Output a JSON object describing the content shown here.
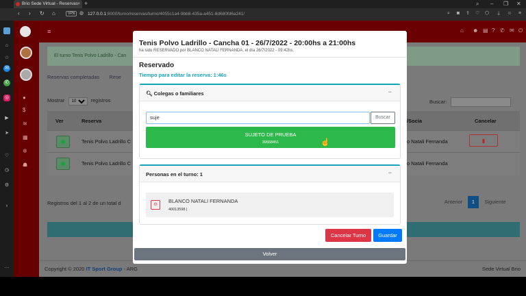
{
  "browser": {
    "tab_title": "Brio Sede Virtual - Reservas",
    "url_host": "127.0.0.1",
    "url_path": ":8000/turno/reservas/turno/4055c1a4-9bb8-435a-a451-8d680fd6a241/",
    "vpn_label": "VPN"
  },
  "page_bg": {
    "alert_text": "El turno Tenis Polvo Ladrillo - Can",
    "tab_completed": "Reservas completadas",
    "tab_other": "Rese",
    "show_label": "Mostrar",
    "show_value": "10",
    "records_label": "registros",
    "search_label": "Buscar:",
    "columns": [
      "Ver",
      "Reserva",
      "/Socia",
      "Cancelar"
    ],
    "rows": [
      {
        "reserva": "Tenis Polvo Ladrillo C",
        "socio": "o Natali Fernanda"
      },
      {
        "reserva": "Tenis Polvo Ladrillo C",
        "socio": "o Natali Fernanda"
      }
    ],
    "records_info": "Registros del 1 al 2 de un total d",
    "pagination": {
      "prev": "Anterior",
      "current": "1",
      "next": "Siguiente"
    },
    "footer_copyright": "Copyright © 2020",
    "footer_brand": "IT Sport Group",
    "footer_suffix": "- ARG",
    "footer_right": "Sede Virtual Brio"
  },
  "modal": {
    "title": "Tenis Polvo Ladrillo - Cancha 01 - 26/7/2022 - 20:00hs a 21:00hs",
    "subtitle": "ha sido RESERVADO por BLANCO NATALI FERNANDA, el día 26/7/2022 - 09:42hs.",
    "status": "Reservado",
    "timer": "Tiempo para editar la reserva: 1:46s",
    "colleagues_card": {
      "title": "Colegas o familiares",
      "search_value": "suje",
      "search_button": "Buscar",
      "result_name": "SUJETO DE PRUEBA",
      "result_dni": "39558451"
    },
    "people_card": {
      "title": "Personas en el turno: 1",
      "person_name": "BLANCO NATALI FERNANDA",
      "person_dni": "40013598 |"
    },
    "cancel_button": "Cancelar Turno",
    "save_button": "Guardar",
    "back_button": "Volver"
  },
  "colors": {
    "accent_teal": "#17a2b8",
    "success": "#2db84b",
    "danger": "#dc3545",
    "primary": "#007bff",
    "app_header": "#6a0000"
  }
}
